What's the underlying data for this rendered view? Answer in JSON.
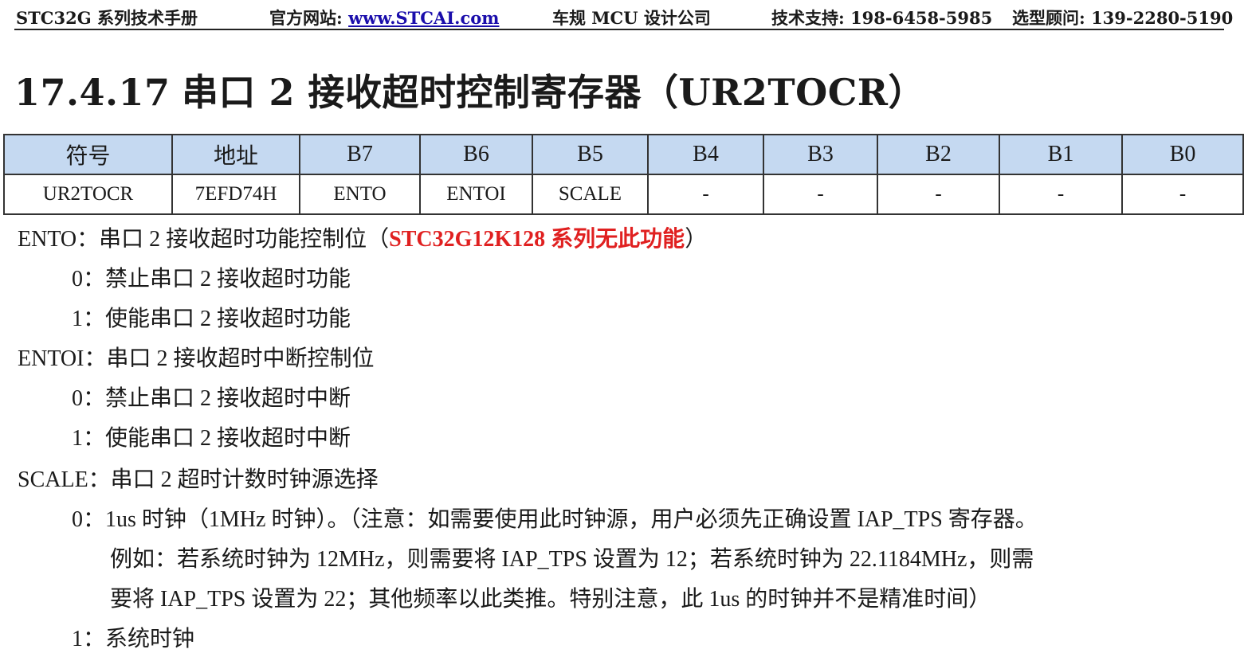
{
  "header": {
    "manual": "STC32G 系列技术手册",
    "site_label": "官方网站: ",
    "site_link": "www.STCAI.com",
    "company": "车规 MCU 设计公司",
    "support": "技术支持: 198-6458-5985",
    "consultant": "选型顾问: 139-2280-5190"
  },
  "section": {
    "number": "17.4.17",
    "title": "串口 2 接收超时控制寄存器（UR2TOCR）"
  },
  "register_table": {
    "headers": [
      "符号",
      "地址",
      "B7",
      "B6",
      "B5",
      "B4",
      "B3",
      "B2",
      "B1",
      "B0"
    ],
    "row": [
      "UR2TOCR",
      "7EFD74H",
      "ENTO",
      "ENTOI",
      "SCALE",
      "-",
      "-",
      "-",
      "-",
      "-"
    ]
  },
  "description": {
    "ento_label": "ENTO：串口 2 接收超时功能控制位（",
    "ento_note": "STC32G12K128 系列无此功能",
    "ento_close": "）",
    "ento_0": "0：禁止串口 2 接收超时功能",
    "ento_1": "1：使能串口 2 接收超时功能",
    "entoi_label": "ENTOI：串口 2 接收超时中断控制位",
    "entoi_0": "0：禁止串口 2 接收超时中断",
    "entoi_1": "1：使能串口 2 接收超时中断",
    "scale_label": "SCALE：串口 2 超时计数时钟源选择",
    "scale_0_a": "0：1us 时钟（1MHz 时钟）。（注意：如需要使用此时钟源，用户必须先正确设置 IAP_TPS 寄存器。",
    "scale_0_b": "例如：若系统时钟为 12MHz，则需要将 IAP_TPS 设置为 12；若系统时钟为 22.1184MHz，则需",
    "scale_0_c": "要将 IAP_TPS 设置为 22；其他频率以此类推。特别注意，此 1us 的时钟并不是精准时间）",
    "scale_1": "1：系统时钟"
  }
}
